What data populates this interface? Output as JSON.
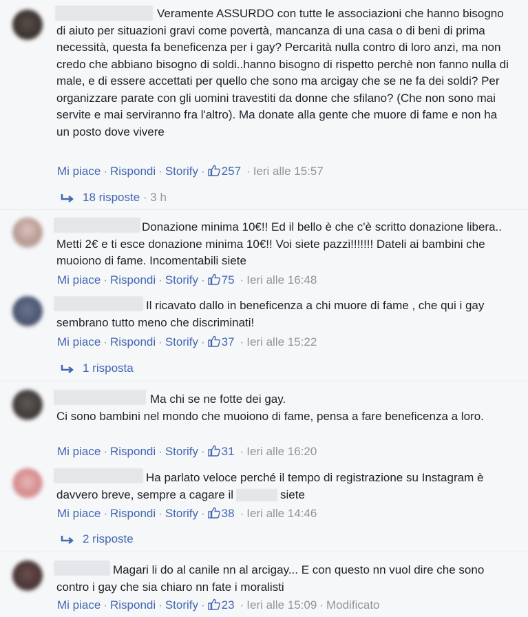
{
  "comments": [
    {
      "text": "Veramente ASSURDO con tutte le associazioni che hanno bisogno di aiuto per situazioni gravi come povertà, mancanza di una casa o di beni di prima necessità, questa fa beneficenza per i gay? Percarità nulla contro di loro anzi, ma non credo che abbiano bisogno di soldi..hanno bisogno di rispetto perchè non fanno nulla di male, e di essere accettati per quello che sono ma arcigay che se ne fa dei soldi? Per organizzare parate con gli uomini travestiti da donne che sfilano? (Che non sono mai servite e mai serviranno fra l'altro). Ma donate alla gente che muore di fame e non ha un posto dove vivere",
      "like_label": "Mi piace",
      "reply_label": "Rispondi",
      "storify_label": "Storify",
      "likes": "257",
      "time": "Ieri alle 15:57",
      "replies": "18 risposte",
      "replies_ago": "3 h"
    },
    {
      "text": "Donazione minima 10€!! Ed il bello è che c'è scritto donazione libera.. Metti 2€ e ti esce donazione minima 10€!! Voi siete pazzi!!!!!!! Dateli ai bambini che muoiono di fame. Incomentabili siete",
      "like_label": "Mi piace",
      "reply_label": "Rispondi",
      "storify_label": "Storify",
      "likes": "75",
      "time": "Ieri alle 16:48"
    },
    {
      "text": "Il ricavato dallo in beneficenza a chi muore di fame , che qui i gay sembrano tutto meno che discriminati!",
      "like_label": "Mi piace",
      "reply_label": "Rispondi",
      "storify_label": "Storify",
      "likes": "37",
      "time": "Ieri alle 15:22",
      "replies": "1 risposta"
    },
    {
      "text_line1": "Ma chi se ne fotte dei gay.",
      "text_rest": "Ci sono bambini nel mondo che muoiono di fame, pensa a fare beneficenza a loro.",
      "like_label": "Mi piace",
      "reply_label": "Rispondi",
      "storify_label": "Storify",
      "likes": "31",
      "time": "Ieri alle 16:20"
    },
    {
      "text_a": "Ha parlato veloce perché il tempo di registrazione su Instagram è davvero breve, sempre a cagare il",
      "text_b": "siete",
      "like_label": "Mi piace",
      "reply_label": "Rispondi",
      "storify_label": "Storify",
      "likes": "38",
      "time": "Ieri alle 14:46",
      "replies": "2 risposte"
    },
    {
      "text": "Magari li do al canile nn al arcigay... E con questo nn vuol dire che sono contro i gay che sia chiaro nn fate i moralisti",
      "like_label": "Mi piace",
      "reply_label": "Rispondi",
      "storify_label": "Storify",
      "likes": "23",
      "time": "Ieri alle 15:09",
      "edited": "Modificato"
    }
  ],
  "colors": {
    "link": "#4267b2",
    "meta": "#90949c",
    "text": "#1d2129",
    "background": "#f6f7f9"
  }
}
